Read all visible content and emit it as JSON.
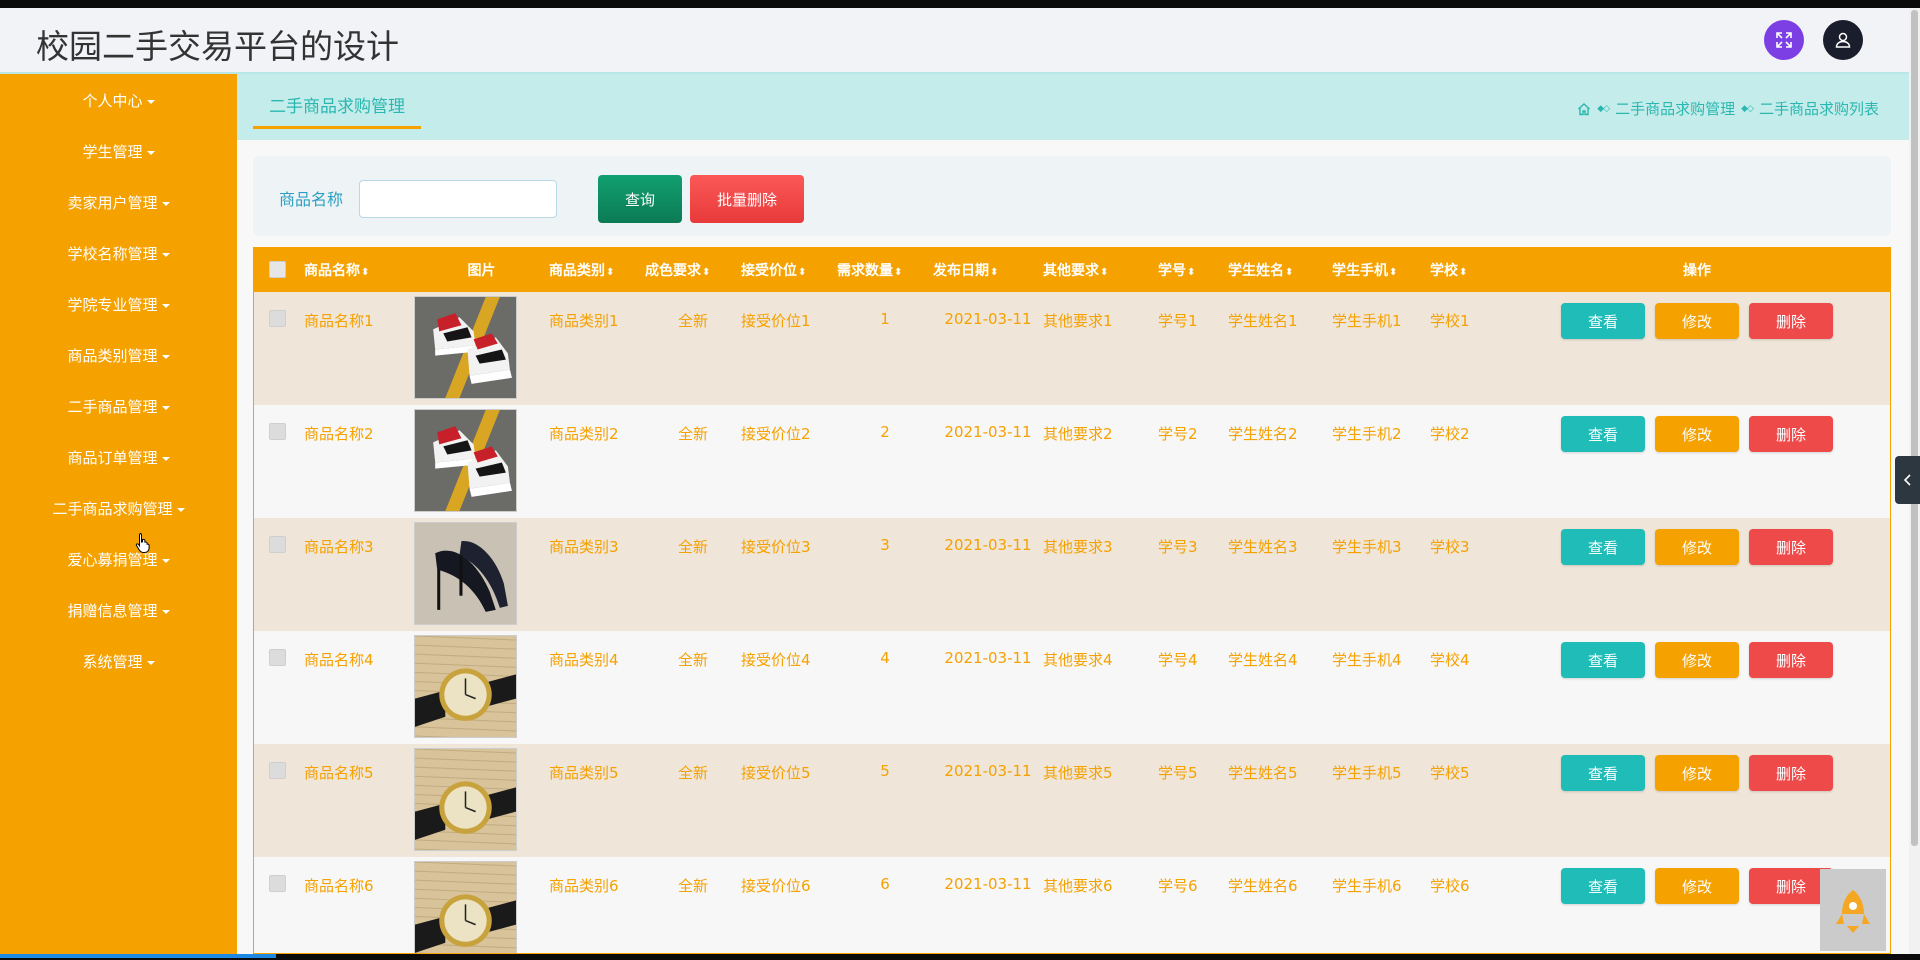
{
  "app": {
    "title": "校园二手交易平台的设计"
  },
  "sidebar": {
    "items": [
      {
        "label": "个人中心"
      },
      {
        "label": "学生管理"
      },
      {
        "label": "卖家用户管理"
      },
      {
        "label": "学校名称管理"
      },
      {
        "label": "学院专业管理"
      },
      {
        "label": "商品类别管理"
      },
      {
        "label": "二手商品管理"
      },
      {
        "label": "商品订单管理"
      },
      {
        "label": "二手商品求购管理"
      },
      {
        "label": "爱心募捐管理"
      },
      {
        "label": "捐赠信息管理"
      },
      {
        "label": "系统管理"
      }
    ]
  },
  "tab": {
    "active_label": "二手商品求购管理"
  },
  "breadcrumb": {
    "level1": "二手商品求购管理",
    "level2": "二手商品求购列表"
  },
  "search": {
    "label": "商品名称",
    "value": "",
    "placeholder": "",
    "query_label": "查询",
    "batch_delete_label": "批量删除"
  },
  "table": {
    "columns": [
      "商品名称",
      "图片",
      "商品类别",
      "成色要求",
      "接受价位",
      "需求数量",
      "发布日期",
      "其他要求",
      "学号",
      "学生姓名",
      "学生手机",
      "学校",
      "操作"
    ],
    "actions": {
      "view": "查看",
      "edit": "修改",
      "delete": "删除"
    },
    "rows": [
      {
        "name": "商品名称1",
        "image": "sneaker",
        "category": "商品类别1",
        "condition": "全新",
        "price": "接受价位1",
        "quantity": "1",
        "date": "2021-03-11",
        "other": "其他要求1",
        "student_no": "学号1",
        "student_name": "学生姓名1",
        "phone": "学生手机1",
        "school": "学校1"
      },
      {
        "name": "商品名称2",
        "image": "sneaker",
        "category": "商品类别2",
        "condition": "全新",
        "price": "接受价位2",
        "quantity": "2",
        "date": "2021-03-11",
        "other": "其他要求2",
        "student_no": "学号2",
        "student_name": "学生姓名2",
        "phone": "学生手机2",
        "school": "学校2"
      },
      {
        "name": "商品名称3",
        "image": "heels",
        "category": "商品类别3",
        "condition": "全新",
        "price": "接受价位3",
        "quantity": "3",
        "date": "2021-03-11",
        "other": "其他要求3",
        "student_no": "学号3",
        "student_name": "学生姓名3",
        "phone": "学生手机3",
        "school": "学校3"
      },
      {
        "name": "商品名称4",
        "image": "watch",
        "category": "商品类别4",
        "condition": "全新",
        "price": "接受价位4",
        "quantity": "4",
        "date": "2021-03-11",
        "other": "其他要求4",
        "student_no": "学号4",
        "student_name": "学生姓名4",
        "phone": "学生手机4",
        "school": "学校4"
      },
      {
        "name": "商品名称5",
        "image": "watch",
        "category": "商品类别5",
        "condition": "全新",
        "price": "接受价位5",
        "quantity": "5",
        "date": "2021-03-11",
        "other": "其他要求5",
        "student_no": "学号5",
        "student_name": "学生姓名5",
        "phone": "学生手机5",
        "school": "学校5"
      },
      {
        "name": "商品名称6",
        "image": "watch",
        "category": "商品类别6",
        "condition": "全新",
        "price": "接受价位6",
        "quantity": "6",
        "date": "2021-03-11",
        "other": "其他要求6",
        "student_no": "学号6",
        "student_name": "学生姓名6",
        "phone": "学生手机6",
        "school": "学校6"
      }
    ]
  },
  "colors": {
    "accent": "#f5a100",
    "teal": "#1fbcb8",
    "danger": "#ef4a4a",
    "subheader": "#c4ecea"
  },
  "icons": {
    "fullscreen": "expand-icon",
    "user": "user-icon",
    "home": "home-icon",
    "collapse": "chevron-left-icon",
    "back_to_top": "rocket-icon"
  }
}
